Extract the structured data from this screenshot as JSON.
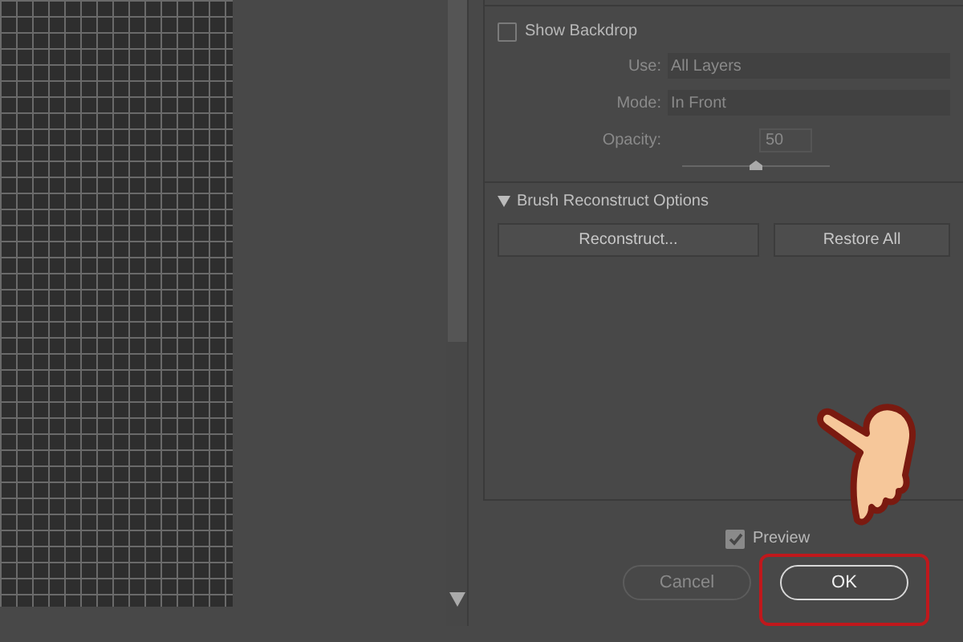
{
  "backdrop": {
    "label": "Show Backdrop",
    "checked": false,
    "fields": [
      {
        "kind": "select",
        "label": "Use:",
        "value": "All Layers",
        "disabled": true
      },
      {
        "kind": "select",
        "label": "Mode:",
        "value": "In Front",
        "disabled": true
      },
      {
        "kind": "number",
        "label": "Opacity:",
        "value": "50",
        "disabled": true,
        "level": 0.5
      }
    ]
  },
  "reconstruct": {
    "title": "Brush Reconstruct Options",
    "expanded": true,
    "buttons": [
      "Reconstruct...",
      "Restore All"
    ]
  },
  "preview": {
    "label": "Preview",
    "checked": true
  },
  "buttons": [
    {
      "label": "Cancel",
      "default": false
    },
    {
      "label": "OK",
      "default": true
    }
  ]
}
